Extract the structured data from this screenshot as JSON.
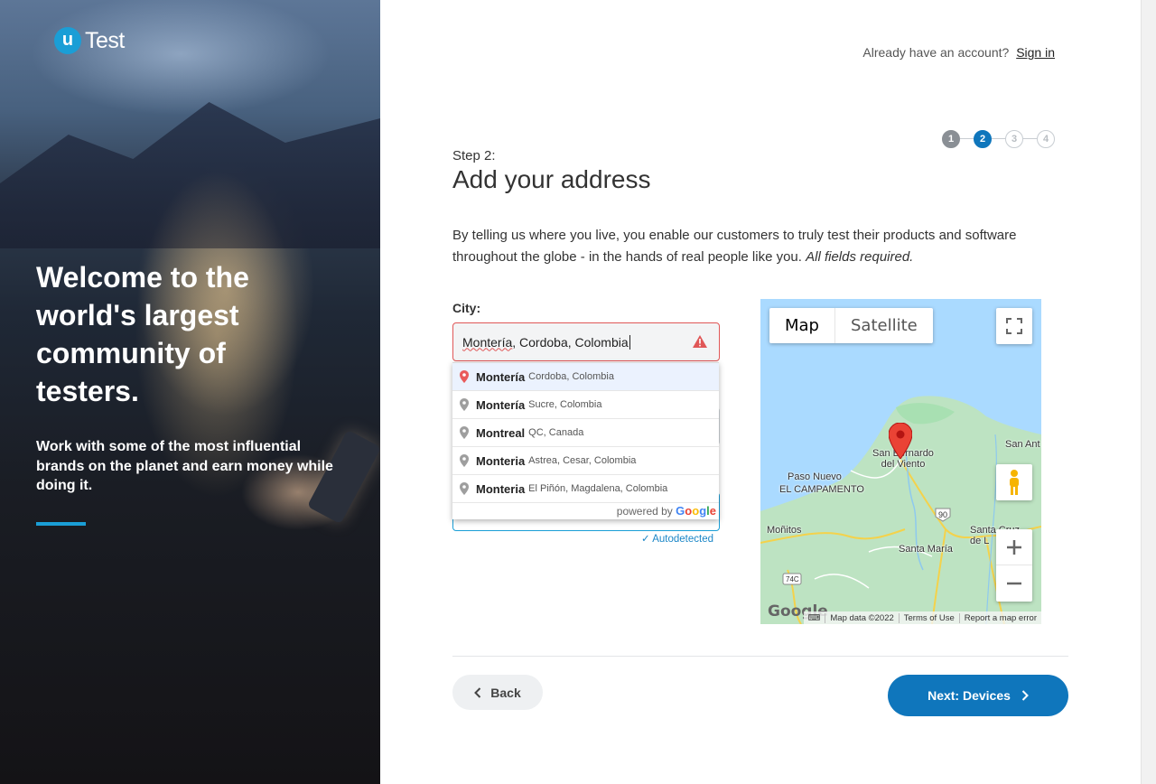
{
  "brand": {
    "logo_mark": "u",
    "logo_text": "Test",
    "accent": "#1a9ed6"
  },
  "hero": {
    "title": "Welcome to the world's largest community of testers.",
    "subtitle": "Work with some of the most influential brands on the planet and earn money while doing it."
  },
  "header": {
    "account_prompt": "Already have an account?",
    "sign_in": "Sign in"
  },
  "stepper": {
    "steps": [
      "1",
      "2",
      "3",
      "4"
    ],
    "current": 2
  },
  "form": {
    "step_label": "Step 2:",
    "title": "Add your address",
    "intro": "By telling us where you live, you enable our customers to truly test their products and software throughout the globe - in the hands of real people like you.",
    "intro_em": "All fields required.",
    "city_label": "City:",
    "city_value_main": "Montería",
    "city_value_rest": ", Cordoba, Colombia",
    "autodetected": "Autodetected"
  },
  "suggestions": [
    {
      "main": "Montería",
      "secondary": "Cordoba, Colombia",
      "selected": true
    },
    {
      "main": "Montería",
      "secondary": "Sucre, Colombia",
      "selected": false
    },
    {
      "main": "Montreal",
      "secondary": "QC, Canada",
      "selected": false
    },
    {
      "main": "Monteria",
      "secondary": "Astrea, Cesar, Colombia",
      "selected": false
    },
    {
      "main": "Monteria",
      "secondary": "El Piñón, Magdalena, Colombia",
      "selected": false
    }
  ],
  "powered_by": {
    "prefix": "powered by",
    "g1": "G",
    "g2": "o",
    "g3": "o",
    "g4": "g",
    "g5": "l",
    "g6": "e"
  },
  "map": {
    "type_map": "Map",
    "type_satellite": "Satellite",
    "labels": {
      "san_bernardo": "San Bernardo del Viento",
      "san_ant": "San Ant",
      "paso_nuevo": "Paso Nuevo",
      "el_campamento": "EL CAMPAMENTO",
      "monitos": "Moñitos",
      "santa_maria": "Santa María",
      "santa_cruz": "Santa Cruz de L",
      "route_90": "90",
      "route_74c": "74C"
    },
    "watermark": "Google",
    "footer": {
      "data": "Map data ©2022",
      "terms": "Terms of Use",
      "report": "Report a map error"
    }
  },
  "nav": {
    "back": "Back",
    "next": "Next: Devices"
  }
}
